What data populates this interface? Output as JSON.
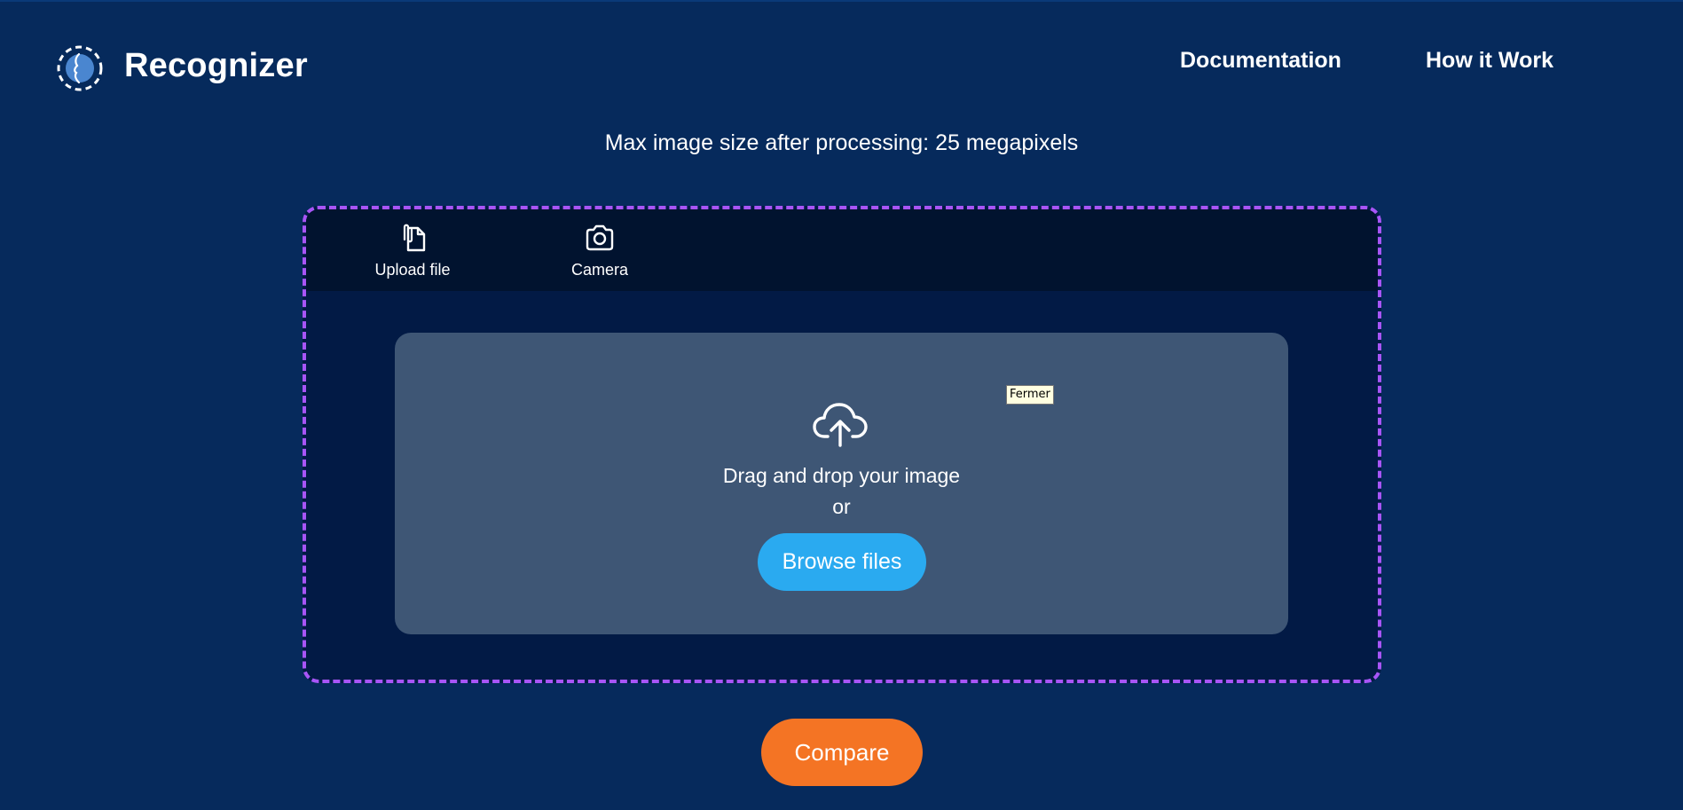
{
  "brand": {
    "name": "Recognizer",
    "logo_icon": "face-profile-logo-icon"
  },
  "nav": {
    "documentation": "Documentation",
    "how_it_works": "How it Work"
  },
  "notice": "Max image size after processing: 25 megapixels",
  "tabs": [
    {
      "label": "Upload file",
      "icon": "document-upload-icon"
    },
    {
      "label": "Camera",
      "icon": "camera-icon"
    }
  ],
  "dropzone": {
    "icon": "cloud-upload-icon",
    "text": "Drag and drop your image",
    "or": "or",
    "browse_label": "Browse files"
  },
  "tooltip": "Fermer",
  "compare_label": "Compare",
  "colors": {
    "background": "#062a5c",
    "panel": "#021a45",
    "tab_bar": "#01132f",
    "dropzone": "#3e5675",
    "dashed_border": "#a855f7",
    "browse_button": "#2aaaf0",
    "compare_button": "#f47424"
  }
}
